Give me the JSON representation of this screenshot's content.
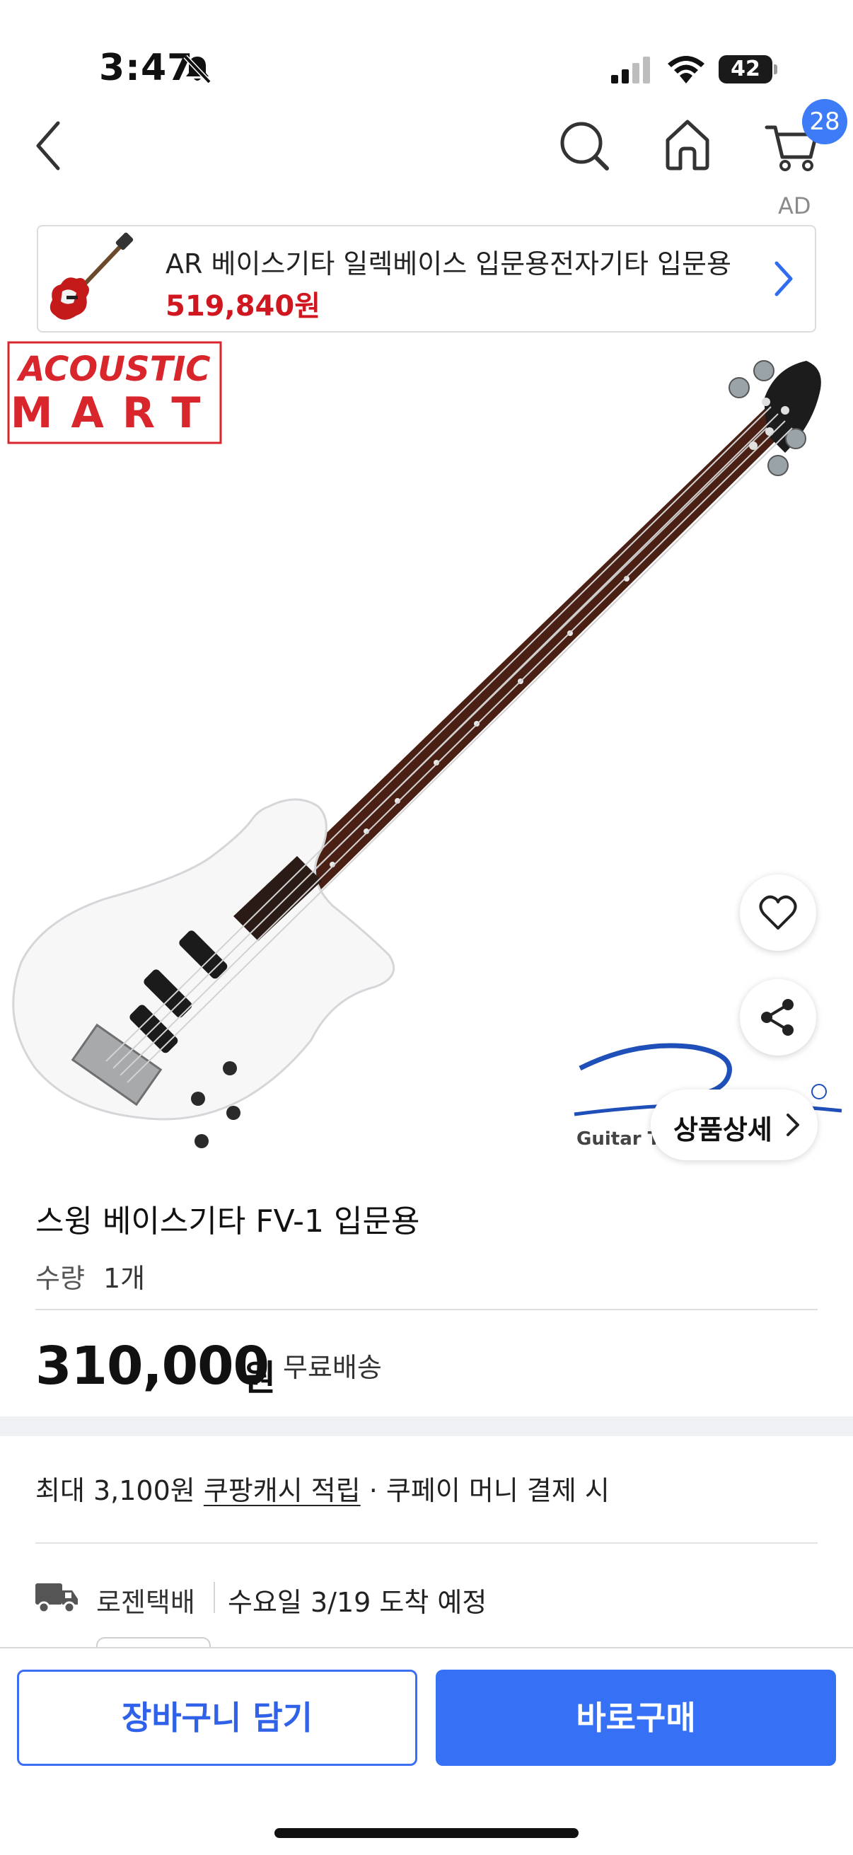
{
  "status_bar": {
    "time": "3:47",
    "battery": "42"
  },
  "nav": {
    "cart_count": "28"
  },
  "ad": {
    "tag": "AD",
    "title": "AR 베이스기타 일렉베이스 입문용전자기타 입문용",
    "price": "519,840원"
  },
  "hero": {
    "watermark_line1": "ACOUSTIC",
    "watermark_line2": "MART",
    "brand_sub": "Guitar Te",
    "detail_button": "상품상세"
  },
  "product": {
    "title": "스윙 베이스기타 FV-1 입문용",
    "qty_label": "수량",
    "qty_value": "1개",
    "price": "310,000",
    "price_unit": "원",
    "shipping": "무료배송"
  },
  "cash": {
    "prefix": "최대 3,100원 ",
    "link": "쿠팡캐시 적립",
    "suffix": " · 쿠페이 머니 결제 시"
  },
  "delivery": {
    "courier": "로젠택배",
    "arrival": "수요일 3/19 도착 예정"
  },
  "bottom": {
    "add_to_cart": "장바구니 담기",
    "buy_now": "바로구매"
  },
  "colors": {
    "accent_blue": "#3570f5",
    "price_red": "#d0161f",
    "badge_blue": "#3d7bf7"
  }
}
